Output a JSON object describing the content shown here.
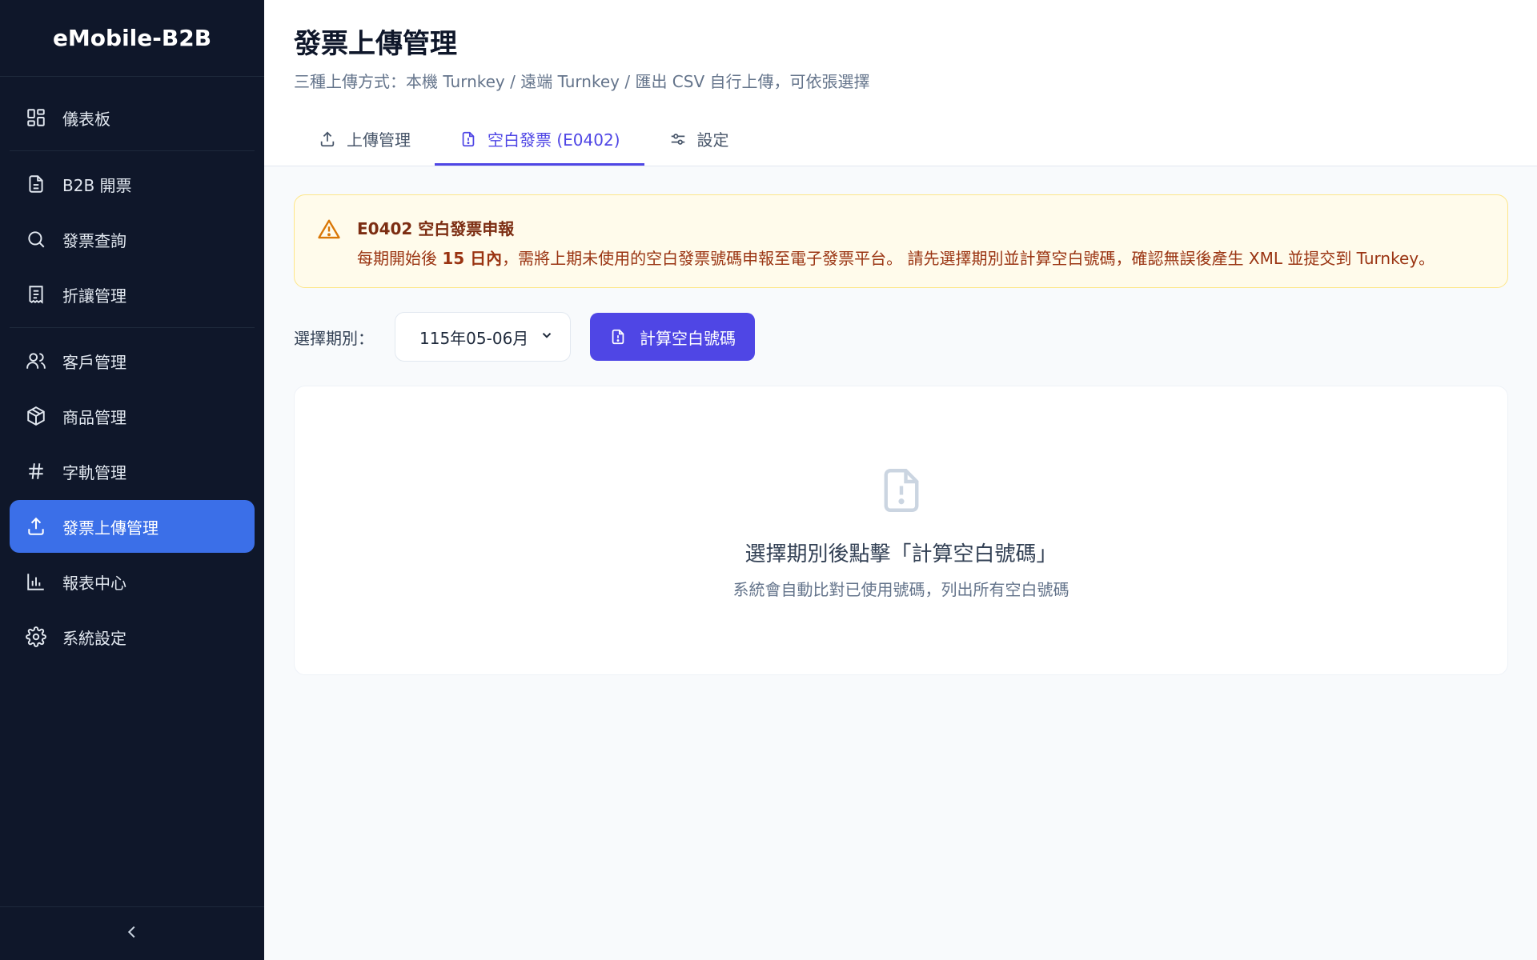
{
  "app": {
    "brand": "eMobile-B2B"
  },
  "sidebar": {
    "items": [
      {
        "label": "儀表板",
        "icon": "dashboard-icon"
      },
      {
        "label": "B2B 開票",
        "icon": "document-icon"
      },
      {
        "label": "發票查詢",
        "icon": "search-icon"
      },
      {
        "label": "折讓管理",
        "icon": "receipt-icon"
      },
      {
        "label": "客戶管理",
        "icon": "users-icon"
      },
      {
        "label": "商品管理",
        "icon": "box-icon"
      },
      {
        "label": "字軌管理",
        "icon": "hash-icon"
      },
      {
        "label": "發票上傳管理",
        "icon": "upload-icon",
        "active": true
      },
      {
        "label": "報表中心",
        "icon": "bar-chart-icon"
      },
      {
        "label": "系統設定",
        "icon": "gear-icon"
      }
    ],
    "active_color": "#3b6fe8"
  },
  "header": {
    "title": "發票上傳管理",
    "subtitle": "三種上傳方式：本機 Turnkey / 遠端 Turnkey / 匯出 CSV 自行上傳，可依張選擇"
  },
  "tabs": [
    {
      "label": "上傳管理",
      "icon": "upload-icon"
    },
    {
      "label": "空白發票 (E0402)",
      "icon": "file-alert-icon",
      "active": true
    },
    {
      "label": "設定",
      "icon": "sliders-icon"
    }
  ],
  "alert": {
    "title": "E0402 空白發票申報",
    "text_prefix": "每期開始後 ",
    "text_bold": "15 日內",
    "text_suffix": "，需將上期未使用的空白發票號碼申報至電子發票平台。 請先選擇期別並計算空白號碼，確認無誤後產生 XML 並提交到 Turnkey。"
  },
  "controls": {
    "period_label": "選擇期別：",
    "period_value": "115年05-06月",
    "calc_button": "計算空白號碼"
  },
  "empty_state": {
    "title": "選擇期別後點擊「計算空白號碼」",
    "description": "系統會自動比對已使用號碼，列出所有空白號碼"
  },
  "colors": {
    "sidebar_bg": "#0f172a",
    "accent": "#4f46e5",
    "alert_bg": "#fffbeb",
    "alert_text": "#9a3412"
  }
}
